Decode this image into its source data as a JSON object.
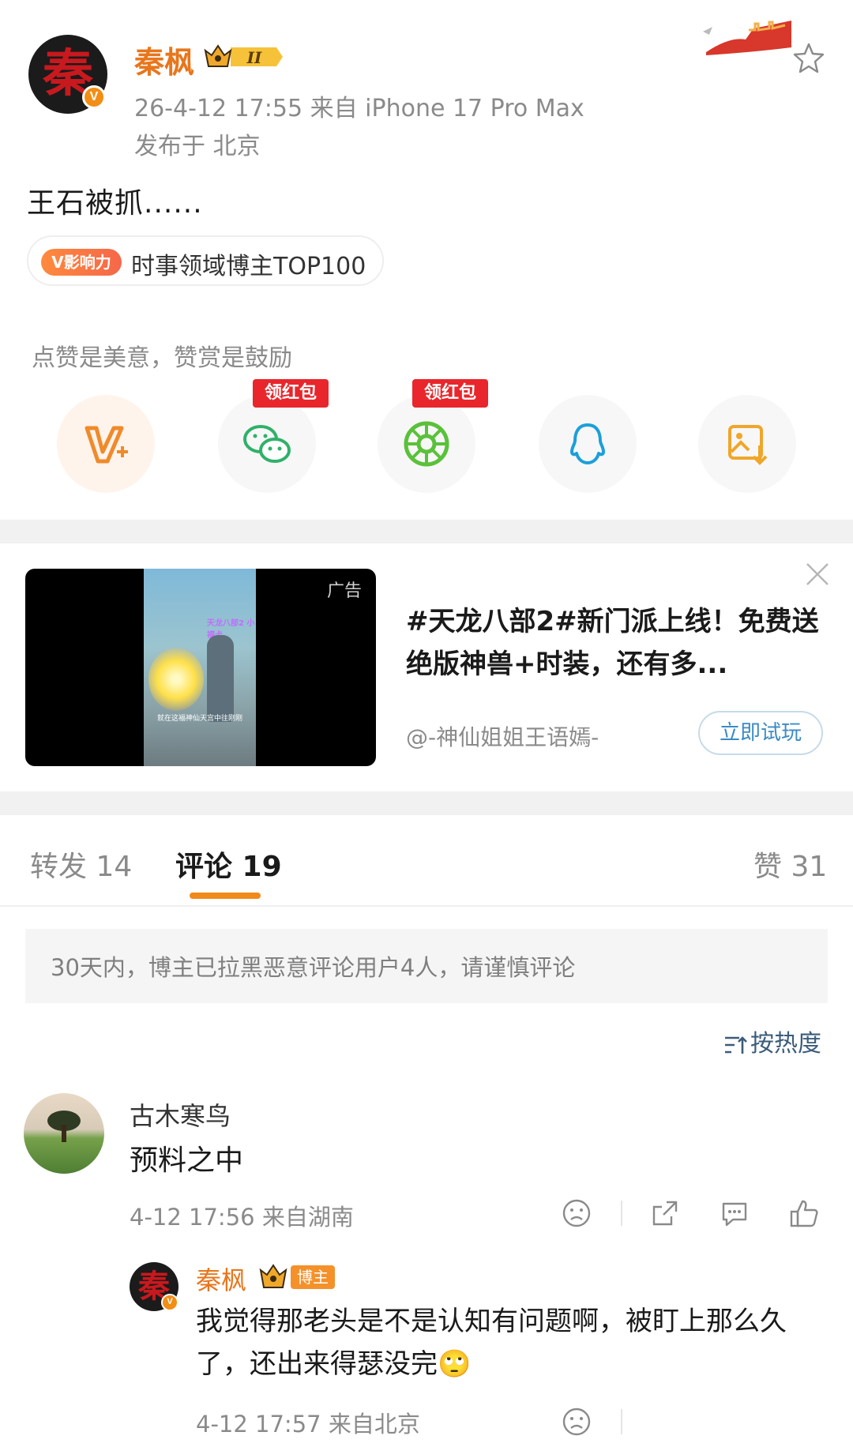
{
  "post": {
    "author": "秦枫",
    "avatar_char": "秦",
    "time_source": "26-4-12 17:55   来自 iPhone 17 Pro Max",
    "location": "发布于 北京",
    "text": "王石被抓......",
    "influence_tag": "V影响力",
    "influence_text": "时事领域博主TOP100",
    "level_badge": "II"
  },
  "reward": {
    "tip": "点赞是美意，赞赏是鼓励",
    "hongbao_label": "领红包",
    "buttons": [
      "vplus-icon",
      "wechat-icon",
      "moments-icon",
      "qq-icon",
      "save-image-icon"
    ]
  },
  "ad": {
    "label": "广告",
    "title": "#天龙八部2#新门派上线！免费送绝版神兽+时装，还有多...",
    "author": "@-神仙姐姐王语嫣-",
    "cta": "立即试玩",
    "overlay_text": "天龙八部2 小福卡",
    "subtitle": "就在这福神仙天宫中往刚刚"
  },
  "tabs": {
    "repost": "转发 14",
    "comment": "评论 19",
    "like": "赞 31"
  },
  "notice": "30天内，博主已拉黑恶意评论用户4人，请谨慎评论",
  "sort": "按热度",
  "comments": [
    {
      "user": "古木寒鸟",
      "text": "预料之中",
      "meta": "4-12 17:56  来自湖南",
      "reply": {
        "user": "秦枫",
        "avatar_char": "秦",
        "tag": "博主",
        "text": "我觉得那老头是不是认知有问题啊，被盯上那么久了，还出来得瑟没完🙄",
        "meta": "4-12 17:57  来自北京"
      }
    }
  ],
  "colors": {
    "accent_orange": "#e8761c",
    "tab_underline": "#f08a1b",
    "hongbao_red": "#e8262b",
    "link_blue": "#3a8bc4"
  }
}
